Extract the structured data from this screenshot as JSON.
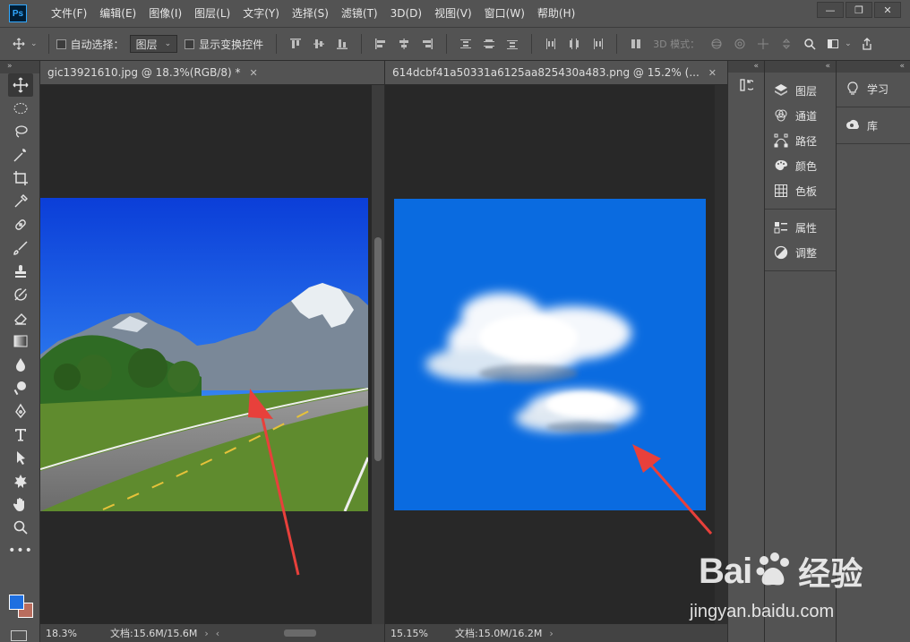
{
  "app": {
    "logo": "Ps"
  },
  "menu": [
    "文件(F)",
    "编辑(E)",
    "图像(I)",
    "图层(L)",
    "文字(Y)",
    "选择(S)",
    "滤镜(T)",
    "3D(D)",
    "视图(V)",
    "窗口(W)",
    "帮助(H)"
  ],
  "window_controls": {
    "minimize": "—",
    "restore": "❐",
    "close": "✕"
  },
  "options": {
    "auto_select_label": "自动选择：",
    "auto_select_value": "图层",
    "show_transform_label": "显示变换控件",
    "mode_3d_label": "3D 模式："
  },
  "docs": [
    {
      "tab": "gic13921610.jpg @ 18.3%(RGB/8) *",
      "zoom": "18.3%",
      "doc_size": "文档:15.6M/15.6M"
    },
    {
      "tab": "614dcbf41a50331a6125aa825430a483.png @ 15.2% (...",
      "zoom": "15.15%",
      "doc_size": "文档:15.0M/16.2M"
    }
  ],
  "panels": {
    "group1": [
      {
        "label": "图层",
        "icon": "layers-icon"
      },
      {
        "label": "通道",
        "icon": "channels-icon"
      },
      {
        "label": "路径",
        "icon": "paths-icon"
      },
      {
        "label": "颜色",
        "icon": "color-icon"
      },
      {
        "label": "色板",
        "icon": "swatches-icon"
      }
    ],
    "group2": [
      {
        "label": "属性",
        "icon": "properties-icon"
      },
      {
        "label": "调整",
        "icon": "adjustments-icon"
      }
    ],
    "group3": [
      {
        "label": "学习",
        "icon": "learn-icon"
      },
      {
        "label": "库",
        "icon": "libraries-icon"
      }
    ]
  },
  "colors": {
    "foreground": "#1e6fe0",
    "background": "#b96d5e",
    "arrow": "#e8403b"
  },
  "watermark": {
    "brand": "Bai",
    "brand_cn": "经验",
    "url": "jingyan.baidu.com"
  }
}
